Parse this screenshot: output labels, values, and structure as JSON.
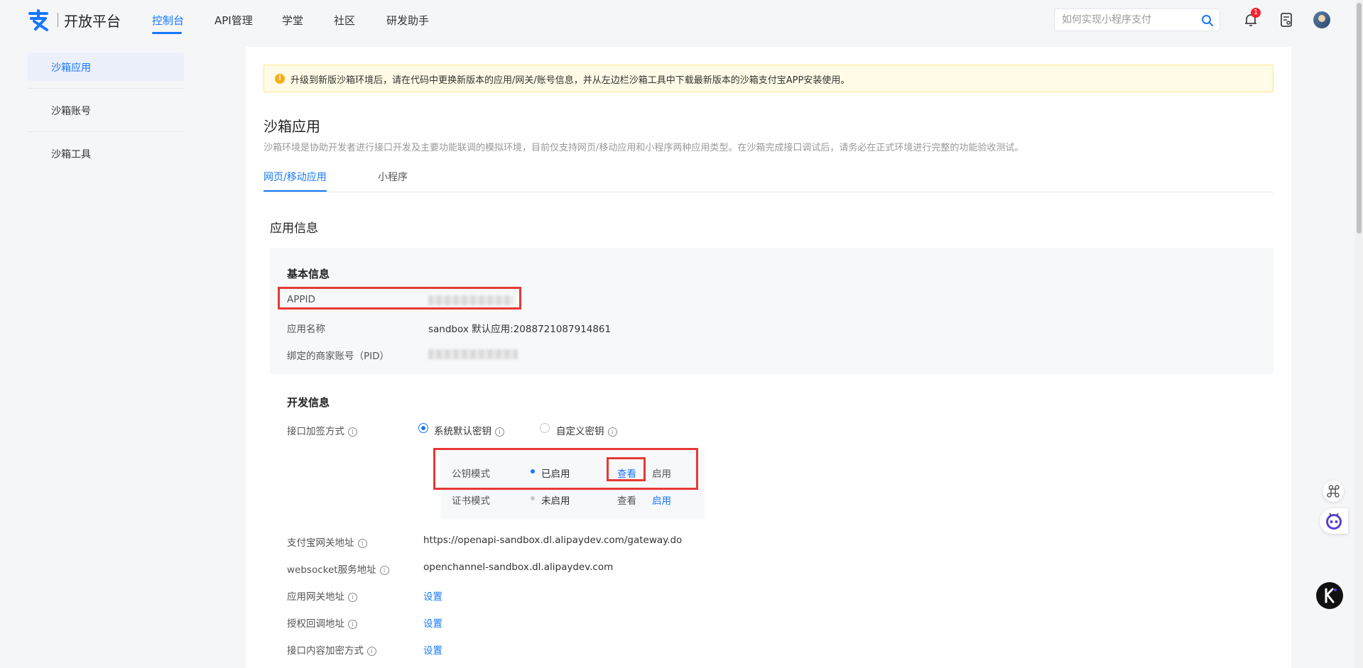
{
  "header": {
    "brand": "开放平台",
    "nav": [
      "控制台",
      "API管理",
      "学堂",
      "社区",
      "研发助手"
    ],
    "search_placeholder": "如何实现小程序支付",
    "notification_count": "1"
  },
  "sidebar": {
    "items": [
      "沙箱应用",
      "沙箱账号",
      "沙箱工具"
    ]
  },
  "notice": "升级到新版沙箱环境后，请在代码中更换新版本的应用/网关/账号信息，并从左边栏沙箱工具中下载最新版本的沙箱支付宝APP安装使用。",
  "page": {
    "title": "沙箱应用",
    "description": "沙箱环境是协助开发者进行接口开发及主要功能联调的模拟环境，目前仅支持网页/移动应用和小程序两种应用类型。在沙箱完成接口调试后，请务必在正式环境进行完整的功能验收测试。",
    "tabs": [
      "网页/移动应用",
      "小程序"
    ]
  },
  "app_info": {
    "title": "应用信息",
    "basic": {
      "title": "基本信息",
      "appid_label": "APPID",
      "name_label": "应用名称",
      "name_value": "sandbox 默认应用:2088721087914861",
      "pid_label": "绑定的商家账号（PID）"
    },
    "dev": {
      "title": "开发信息",
      "sign_label": "接口加签方式",
      "radio_default": "系统默认密钥",
      "radio_custom": "自定义密钥",
      "modes": [
        {
          "name": "公钥模式",
          "status": "已启用",
          "view": "查看",
          "enable": "启用"
        },
        {
          "name": "证书模式",
          "status": "未启用",
          "view": "查看",
          "enable": "启用"
        }
      ],
      "gateway_label": "支付宝网关地址",
      "gateway_value": "https://openapi-sandbox.dl.alipaydev.com/gateway.do",
      "ws_label": "websocket服务地址",
      "ws_value": "openchannel-sandbox.dl.alipaydev.com",
      "app_gateway_label": "应用网关地址",
      "auth_callback_label": "授权回调地址",
      "encrypt_label": "接口内容加密方式",
      "set_link": "设置"
    }
  },
  "colors": {
    "accent": "#1677ff",
    "highlight": "#e53935",
    "notice_bg": "#fffbe6",
    "notice_icon": "#faad14"
  }
}
